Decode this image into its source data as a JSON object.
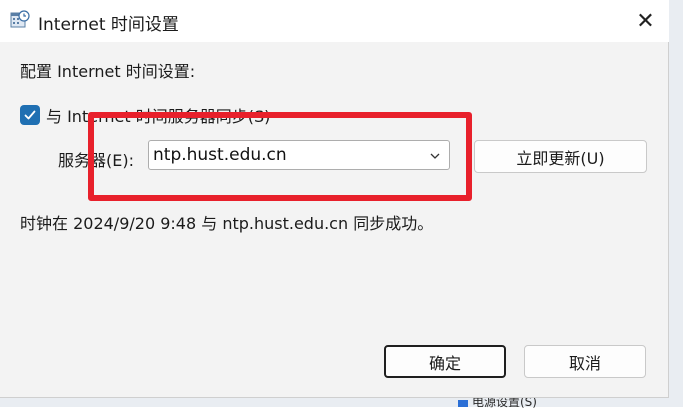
{
  "window": {
    "title": "Internet 时间设置",
    "icon": "calendar-clock-icon",
    "close_glyph": "✕"
  },
  "content": {
    "config_label": "配置 Internet 时间设置:",
    "sync_checkbox": {
      "checked": true,
      "label": "与 Internet 时间服务器同步(S)"
    },
    "server": {
      "label": "服务器(E):",
      "value": "ntp.hust.edu.cn"
    },
    "update_button": "立即更新(U)",
    "status": "时钟在 2024/9/20 9:48 与 ntp.hust.edu.cn 同步成功。"
  },
  "buttons": {
    "ok": "确定",
    "cancel": "取消"
  },
  "background": {
    "peek_text": "电源设置(S)"
  },
  "colors": {
    "accent": "#1f6fb2",
    "highlight": "#e8202b"
  }
}
